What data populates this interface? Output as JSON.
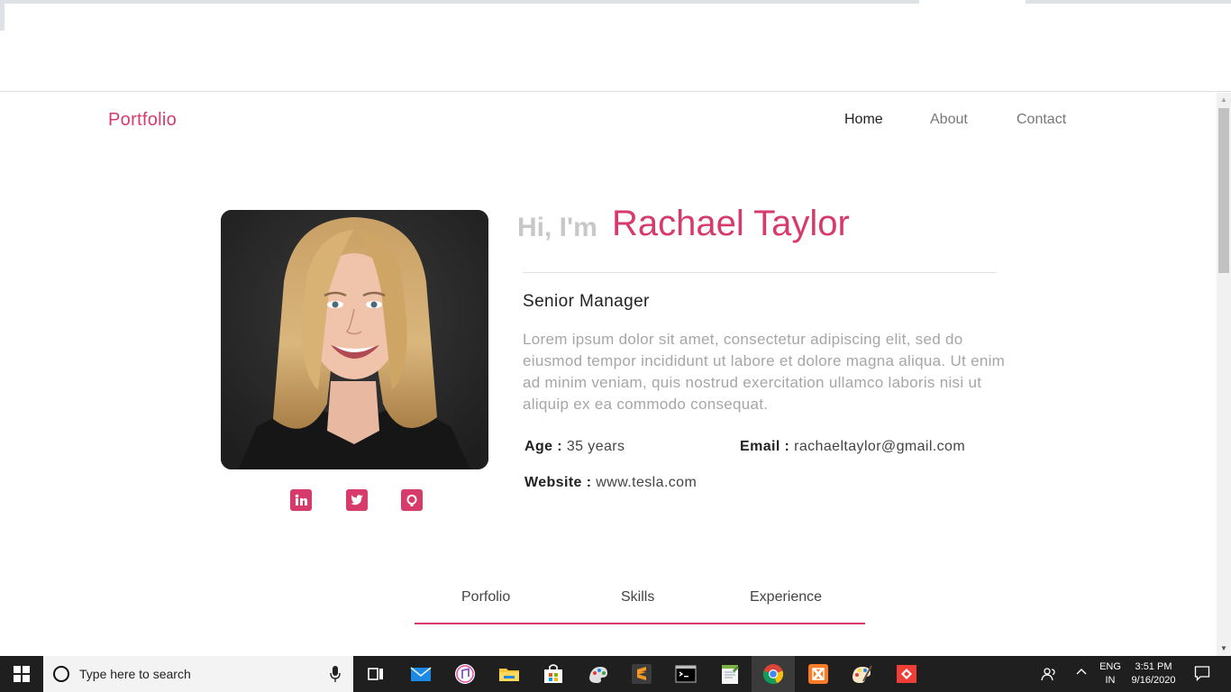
{
  "navbar": {
    "brand": "Portfolio",
    "links": [
      "Home",
      "About",
      "Contact"
    ]
  },
  "profile": {
    "greeting": "Hi, I'm",
    "name": "Rachael Taylor",
    "job_title": "Senior Manager",
    "bio": "Lorem ipsum dolor sit amet, consectetur adipiscing elit, sed do eiusmod tempor incididunt ut labore et dolore magna aliqua. Ut enim ad minim veniam, quis nostrud exercitation ullamco laboris nisi ut aliquip ex ea commodo consequat.",
    "age_label": "Age :",
    "age_value": "35 years",
    "email_label": "Email :",
    "email_value": "rachaeltaylor@gmail.com",
    "website_label": "Website :",
    "website_value": "www.tesla.com",
    "social_icons": [
      "linkedin-icon",
      "twitter-icon",
      "github-icon"
    ]
  },
  "tabs": [
    "Porfolio",
    "Skills",
    "Experience"
  ],
  "colors": {
    "accent": "#d63b6c",
    "greeting": "#c8c8c8",
    "bio_text": "#a6a6a6"
  },
  "taskbar": {
    "search_placeholder": "Type here to search",
    "apps": [
      "task-view-icon",
      "mail-icon",
      "itunes-icon",
      "file-explorer-icon",
      "store-icon",
      "paint-3d-icon",
      "sublime-text-icon",
      "cmd-icon",
      "notepad-icon",
      "chrome-icon",
      "xampp-icon",
      "paint-icon",
      "anydesk-icon"
    ],
    "lang_line1": "ENG",
    "lang_line2": "IN",
    "time": "3:51 PM",
    "date": "9/16/2020"
  }
}
